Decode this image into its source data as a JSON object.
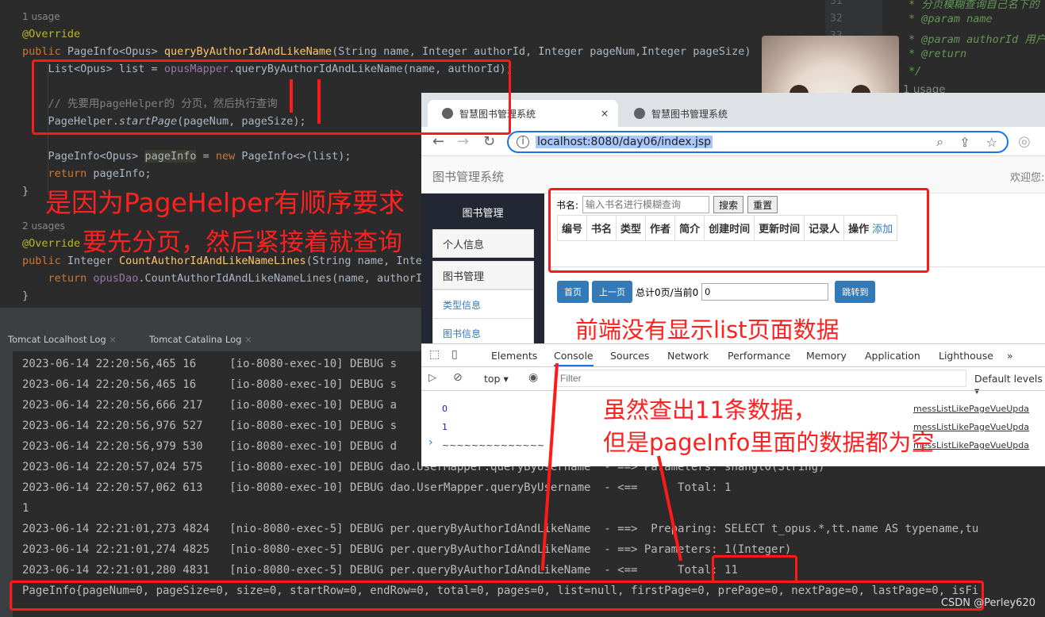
{
  "editor": {
    "lines": [
      [
        {
          "t": "1 usage",
          "c": "usage"
        }
      ],
      [
        {
          "t": "@Override",
          "c": "an"
        }
      ],
      [
        {
          "t": "public ",
          "c": "kw"
        },
        {
          "t": "PageInfo<Opus> "
        },
        {
          "t": "queryByAuthorIdAndLikeName",
          "c": "fn"
        },
        {
          "t": "(String name, Integer authorId, Integer pageNum,Integer pageSize) {"
        }
      ],
      [
        {
          "t": "    List<Opus> list = "
        },
        {
          "t": "opusMapper",
          "c": "fld"
        },
        {
          "t": ".queryByAuthorIdAndLikeName(name, authorId);"
        }
      ],
      [
        {
          "t": ""
        }
      ],
      [
        {
          "t": "    // 先要用pageHelper的 分页，然后执行查询",
          "c": "cm"
        }
      ],
      [
        {
          "t": "    PageHelper."
        },
        {
          "t": "startPage",
          "c": "it"
        },
        {
          "t": "(pageNum, pageSize);"
        }
      ],
      [
        {
          "t": ""
        }
      ],
      [
        {
          "t": "    PageInfo<Opus> "
        },
        {
          "t": "pageInfo",
          "c": "hl"
        },
        {
          "t": " = "
        },
        {
          "t": "new ",
          "c": "kw"
        },
        {
          "t": "PageInfo<>(list);"
        }
      ],
      [
        {
          "t": "    "
        },
        {
          "t": "return ",
          "c": "kw"
        },
        {
          "t": "pageInfo;"
        }
      ],
      [
        {
          "t": "}"
        }
      ],
      [
        {
          "t": ""
        }
      ],
      [
        {
          "t": "2 usages",
          "c": "usage"
        }
      ],
      [
        {
          "t": "@Override",
          "c": "an"
        }
      ],
      [
        {
          "t": "public ",
          "c": "kw"
        },
        {
          "t": "Integer "
        },
        {
          "t": "CountAuthorIdAndLikeNameLines",
          "c": "fn"
        },
        {
          "t": "(String name, Integ"
        }
      ],
      [
        {
          "t": "    "
        },
        {
          "t": "return ",
          "c": "kw"
        },
        {
          "t": "opusDao",
          "c": "fld"
        },
        {
          "t": ".CountAuthorIdAndLikeNameLines(name, authorId"
        }
      ],
      [
        {
          "t": "}"
        }
      ]
    ],
    "right_gutter": [
      "31",
      "32",
      "33"
    ],
    "right_lines": [
      "* 分页模糊查询自己名下的 多",
      "* @param name",
      "* @param authorId 用户",
      "* @return",
      "*/"
    ],
    "right_usage": "1 usage"
  },
  "browser": {
    "tabs": [
      {
        "label": "智慧图书管理系统",
        "active": true,
        "close": "×"
      },
      {
        "label": "智慧图书管理系统",
        "active": false
      }
    ],
    "url": "localhost:8080/day06/index.jsp",
    "site_title": "图书管理系统",
    "welcome": "欢迎您:",
    "sidebar": {
      "header": "图书管理",
      "items": [
        "个人信息",
        "图书管理"
      ],
      "links": [
        "类型信息",
        "图书信息"
      ]
    },
    "search": {
      "label": "书名:",
      "placeholder": "输入书名进行模糊查询",
      "search_btn": "搜索",
      "reset_btn": "重置"
    },
    "table_headers": [
      "编号",
      "书名",
      "类型",
      "作者",
      "简介",
      "创建时间",
      "更新时间",
      "记录人",
      "操作"
    ],
    "add_link": "添加",
    "pager": {
      "first": "首页",
      "prev": "上一页",
      "summary": "总计0页/当前0",
      "page_value": "0",
      "jump": "跳转到"
    }
  },
  "devtools": {
    "tabs": [
      "Elements",
      "Console",
      "Sources",
      "Network",
      "Performance",
      "Memory",
      "Application",
      "Lighthouse",
      "»"
    ],
    "active_tab": "Console",
    "context": "top ▾",
    "filter_placeholder": "Filter",
    "levels": "Default levels ▾",
    "messages": [
      {
        "text": "0",
        "src": "messListLikePageVueUpda"
      },
      {
        "text": "1",
        "src": "messListLikePageVueUpda"
      },
      {
        "text": "~~~~~~~~~~~~~~",
        "src": "messListLikePageVueUpda"
      }
    ],
    "prompt": "›"
  },
  "toolwindow": {
    "tabs": [
      "Tomcat Localhost Log",
      "Tomcat Catalina Log"
    ]
  },
  "log": [
    "2023-06-14 22:20:56,465 16     [io-8080-exec-10] DEBUG s",
    "2023-06-14 22:20:56,465 16     [io-8080-exec-10] DEBUG s",
    "2023-06-14 22:20:56,666 217    [io-8080-exec-10] DEBUG a",
    "2023-06-14 22:20:56,976 527    [io-8080-exec-10] DEBUG s",
    "2023-06-14 22:20:56,979 530    [io-8080-exec-10] DEBUG d",
    "2023-06-14 22:20:57,024 575    [io-8080-exec-10] DEBUG dao.UserMapper.queryByUsername  - ==> Parameters: shangl0(String)",
    "2023-06-14 22:20:57,062 613    [io-8080-exec-10] DEBUG dao.UserMapper.queryByUsername  - <==      Total: 1",
    "1",
    "2023-06-14 22:21:01,273 4824   [nio-8080-exec-5] DEBUG per.queryByAuthorIdAndLikeName  - ==>  Preparing: SELECT t_opus.*,tt.name AS typename,tu",
    "2023-06-14 22:21:01,274 4825   [nio-8080-exec-5] DEBUG per.queryByAuthorIdAndLikeName  - ==> Parameters: 1(Integer)",
    "2023-06-14 22:21:01,280 4831   [nio-8080-exec-5] DEBUG per.queryByAuthorIdAndLikeName  - <==      Total: 11",
    "PageInfo{pageNum=0, pageSize=0, size=0, startRow=0, endRow=0, total=0, pages=0, list=null, firstPage=0, prePage=0, nextPage=0, lastPage=0, isFi"
  ],
  "annotations": {
    "a1": "是因为PageHelper有顺序要求",
    "a2": "要先分页，然后紧接着就查询",
    "a3": "前端没有显示list页面数据",
    "a4": "虽然查出11条数据，",
    "a5": "但是pageInfo里面的数据都为空"
  },
  "watermark": "CSDN @Perley620",
  "colors": {
    "annotation": "#ff1a1a",
    "editor_bg": "#2b2b2b",
    "link": "#337ab7",
    "focus": "#1a73e8"
  }
}
